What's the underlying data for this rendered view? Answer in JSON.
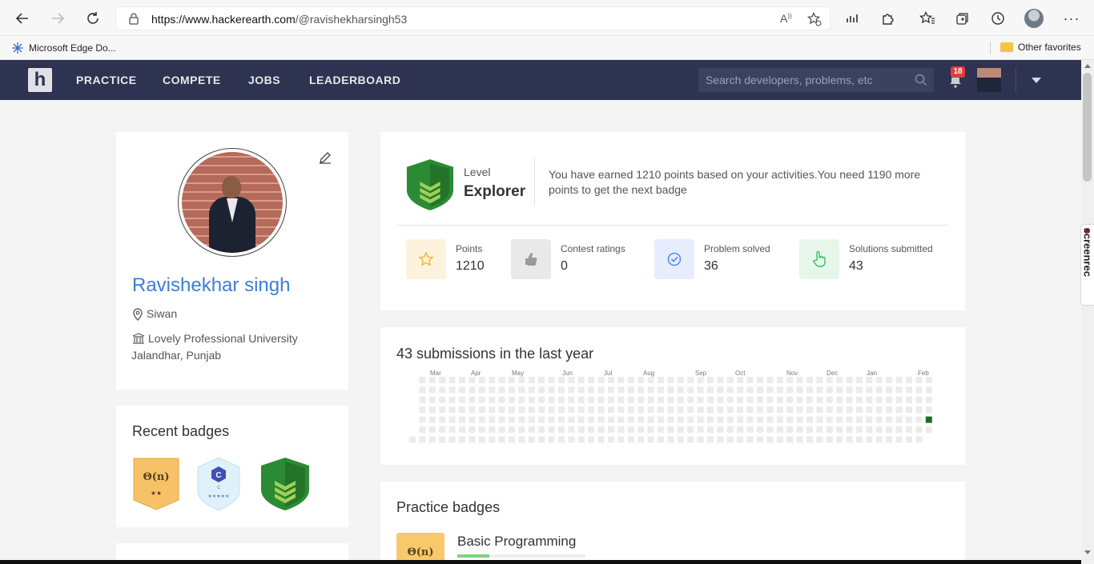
{
  "browser": {
    "url_host": "https://www.hackerearth.com",
    "url_path": "/@ravishekharsingh53",
    "favorites": [
      {
        "label": "Microsoft Edge Do...",
        "icon": "edge-sparkle-icon"
      },
      {
        "label": "Other favorites",
        "icon": "folder-icon"
      }
    ]
  },
  "header": {
    "logo": "h",
    "nav": [
      "PRACTICE",
      "COMPETE",
      "JOBS",
      "LEADERBOARD"
    ],
    "search_placeholder": "Search developers, problems, etc",
    "notifications": "18"
  },
  "profile": {
    "name": "Ravishekhar singh",
    "location": "Siwan",
    "institution_line1": "Lovely Professional University",
    "institution_line2": "Jalandhar, Punjab"
  },
  "recent_badges": {
    "title": "Recent badges",
    "items": [
      {
        "name": "complexity-badge",
        "text": "Θ(n)",
        "stars": "★★"
      },
      {
        "name": "c-language-badge",
        "text": "C",
        "stars": "★★★★★"
      },
      {
        "name": "explorer-level-badge",
        "text": "",
        "stars": ""
      }
    ]
  },
  "level": {
    "label": "Level",
    "name": "Explorer",
    "message": "You have earned 1210 points based on your activities.You need 1190 more points to get the next badge"
  },
  "stats": [
    {
      "label": "Points",
      "value": "1210",
      "icon": "star-icon",
      "color": "#fdf3dc"
    },
    {
      "label": "Contest ratings",
      "value": "0",
      "icon": "thumbs-up-icon",
      "color": "#e9e9ea"
    },
    {
      "label": "Problem solved",
      "value": "36",
      "icon": "check-circle-icon",
      "color": "#e6edfc"
    },
    {
      "label": "Solutions submitted",
      "value": "43",
      "icon": "pointer-hand-icon",
      "color": "#e6f6ea"
    }
  ],
  "submissions": {
    "title": "43 submissions in the last year",
    "months": [
      "Mar",
      "Apr",
      "May",
      "Jun",
      "Jul",
      "Aug",
      "Sep",
      "Oct",
      "Nov",
      "Dec",
      "Jan",
      "Feb"
    ],
    "colors": {
      "empty": "#ebebeb",
      "active": "#1e6b22"
    }
  },
  "practice": {
    "title": "Practice badges",
    "first_badge": "Basic Programming",
    "first_badge_text": "Θ(n)",
    "first_badge_progress": 0.25
  },
  "sidebar_ext": {
    "screenrec": "screenrec"
  }
}
